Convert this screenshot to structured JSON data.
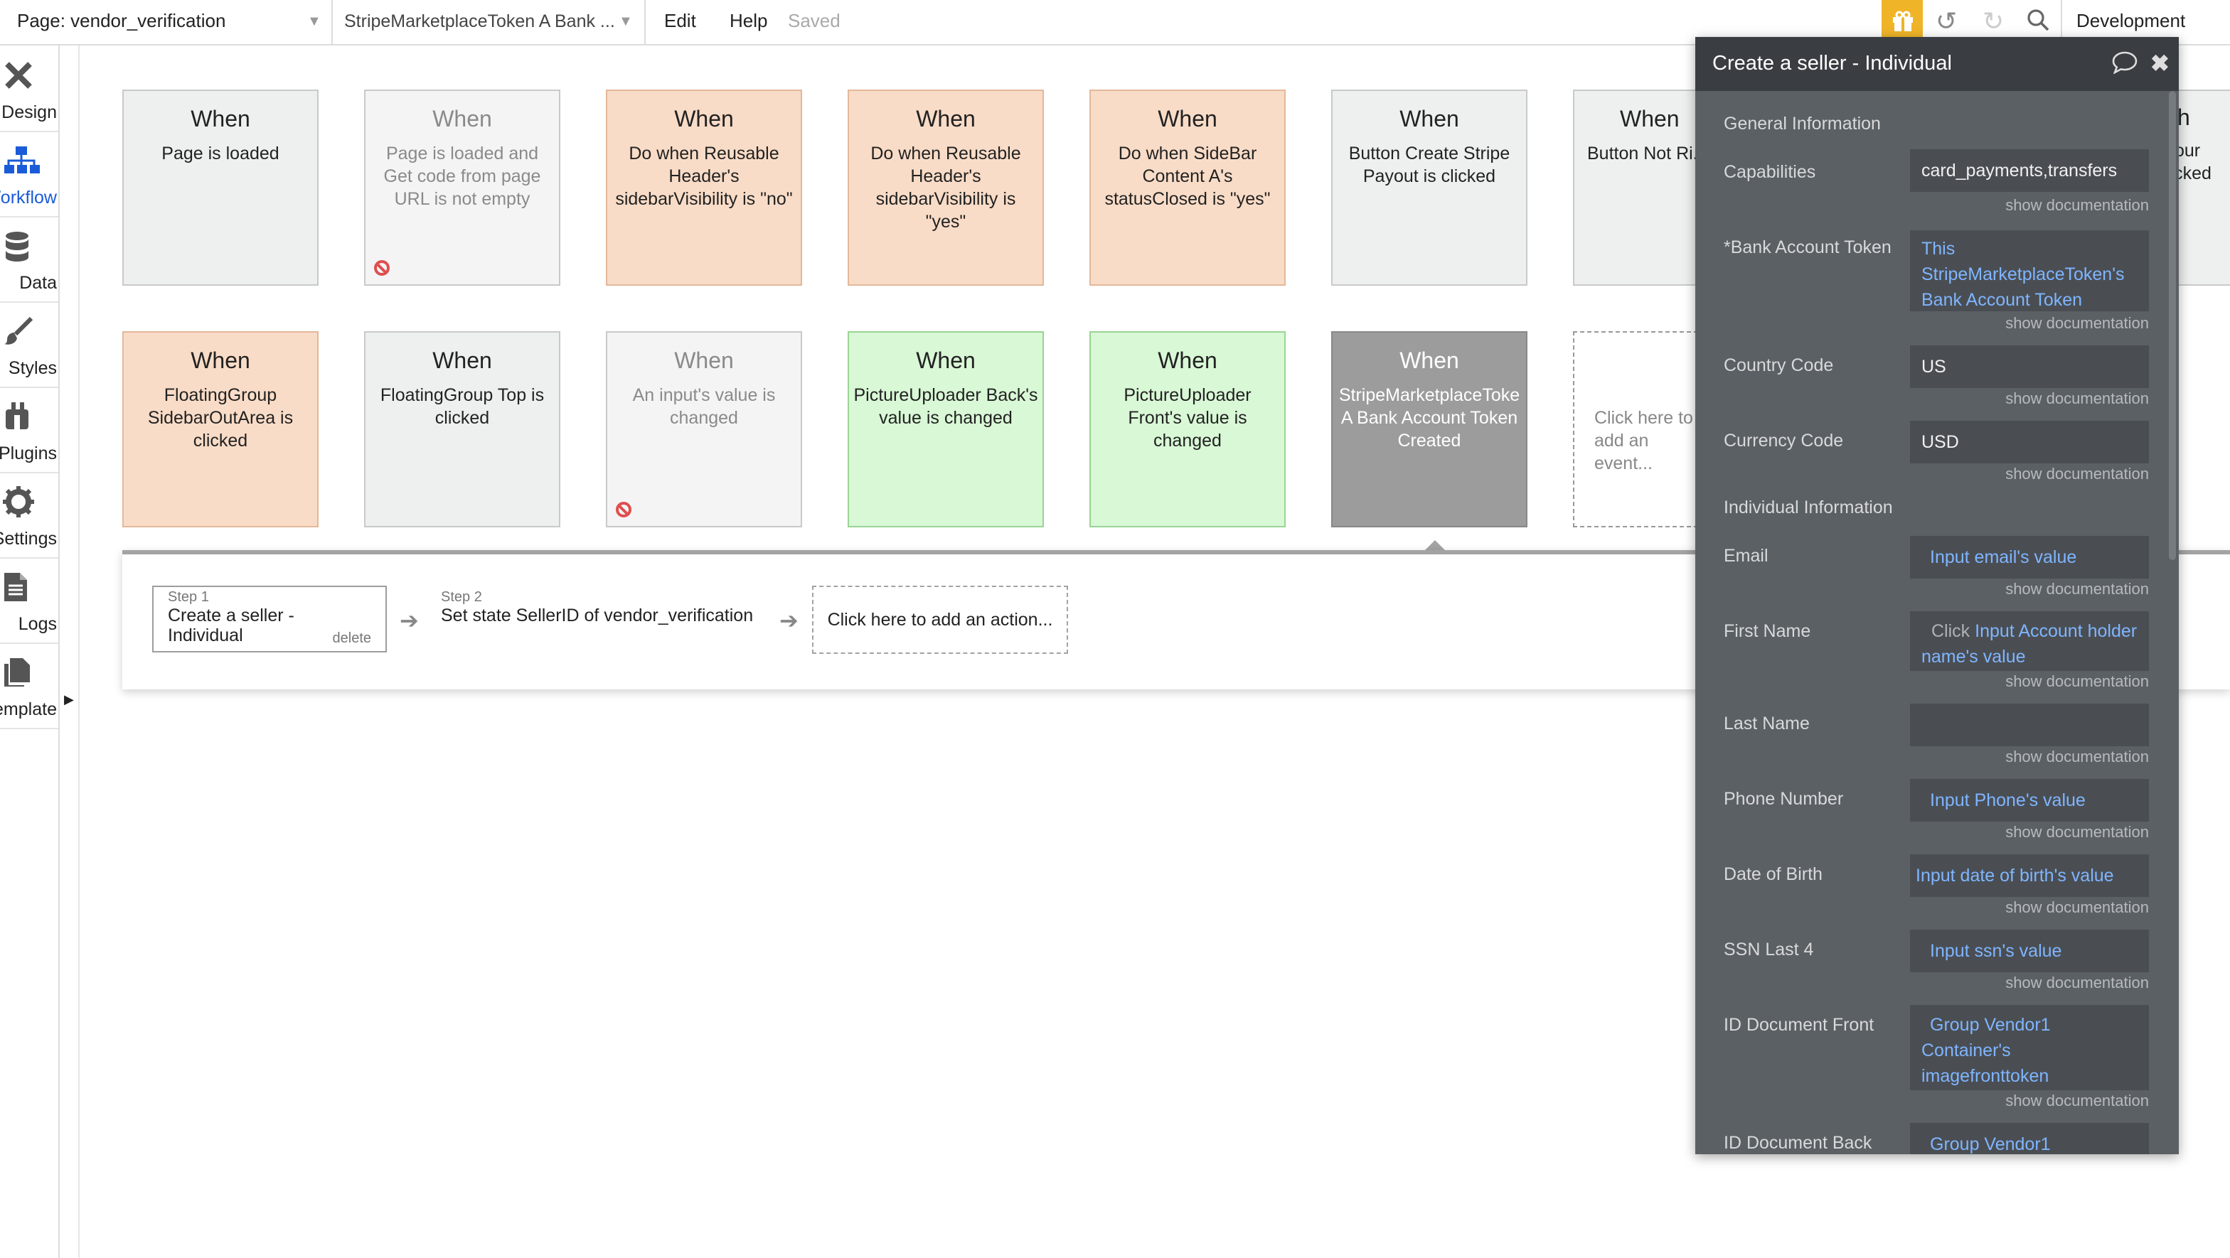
{
  "topbar": {
    "page_label": "Page: vendor_verification",
    "token_label": "StripeMarketplaceToken A Bank ...",
    "edit": "Edit",
    "help": "Help",
    "saved": "Saved",
    "environment": "Development"
  },
  "sidebar": {
    "items": [
      {
        "label": "Design",
        "icon": "design-icon"
      },
      {
        "label": "Workflow",
        "icon": "workflow-icon"
      },
      {
        "label": "Data",
        "icon": "database-icon"
      },
      {
        "label": "Styles",
        "icon": "brush-icon"
      },
      {
        "label": "Plugins",
        "icon": "plug-icon"
      },
      {
        "label": "Settings",
        "icon": "gear-icon"
      },
      {
        "label": "Logs",
        "icon": "document-icon"
      },
      {
        "label": "Template",
        "icon": "copy-icon"
      }
    ]
  },
  "events": {
    "row1": [
      {
        "when": "When",
        "text": "Page is loaded"
      },
      {
        "when": "When",
        "text": "Page is loaded and Get code from page URL is not empty"
      },
      {
        "when": "When",
        "text": "Do when Reusable Header's sidebarVisibility is \"no\""
      },
      {
        "when": "When",
        "text": "Do when Reusable Header's sidebarVisibility is \"yes\""
      },
      {
        "when": "When",
        "text": "Do when SideBar Content A's statusClosed is \"yes\""
      },
      {
        "when": "When",
        "text": "Button Create Stripe Payout is clicked"
      },
      {
        "when": "When",
        "text": "Button Not Ri... is clicke..."
      }
    ],
    "row2": [
      {
        "when": "When",
        "text": "FloatingGroup SidebarOutArea is clicked"
      },
      {
        "when": "When",
        "text": "FloatingGroup Top is clicked"
      },
      {
        "when": "When",
        "text": "An input's value is changed"
      },
      {
        "when": "When",
        "text": "PictureUploader Back's value is changed"
      },
      {
        "when": "When",
        "text": "PictureUploader Front's value is changed"
      },
      {
        "when": "When",
        "text": "StripeMarketplaceToke A Bank Account Token Created"
      },
      {
        "when": "",
        "text": "Click here to add an event..."
      }
    ],
    "partial_right": {
      "line1": "h",
      "line2": "y your",
      "line3": "licked"
    }
  },
  "actions": {
    "step1": {
      "step": "Step 1",
      "label": "Create a seller - Individual",
      "delete": "delete"
    },
    "step2": {
      "step": "Step 2",
      "label": "Set state SellerID of vendor_verification"
    },
    "add": "Click here to add an action..."
  },
  "panel": {
    "title": "Create a seller - Individual",
    "show_doc": "show documentation",
    "general_heading": "General Information",
    "individual_heading": "Individual Information",
    "fields": {
      "capabilities": {
        "label": "Capabilities",
        "value": "card_payments,transfers"
      },
      "bank_token": {
        "label": "*Bank Account Token",
        "value": "This StripeMarketplaceToken's Bank Account Token"
      },
      "country": {
        "label": "Country Code",
        "value": "US"
      },
      "currency": {
        "label": "Currency Code",
        "value": "USD"
      },
      "email": {
        "label": "Email",
        "value": "Input email's value"
      },
      "first_name": {
        "label": "First Name",
        "prefix": "Click",
        "value": "Input Account holder name's value"
      },
      "last_name": {
        "label": "Last Name",
        "value": ""
      },
      "phone": {
        "label": "Phone Number",
        "value": "Input Phone's value"
      },
      "dob": {
        "label": "Date of Birth",
        "value": "Input date of birth's value"
      },
      "ssn": {
        "label": "SSN Last 4",
        "value": "Input ssn's value"
      },
      "id_front": {
        "label": "ID Document Front",
        "value": "Group Vendor1 Container's imagefronttoken"
      },
      "id_back": {
        "label": "ID Document Back",
        "value": "Group Vendor1"
      }
    }
  }
}
